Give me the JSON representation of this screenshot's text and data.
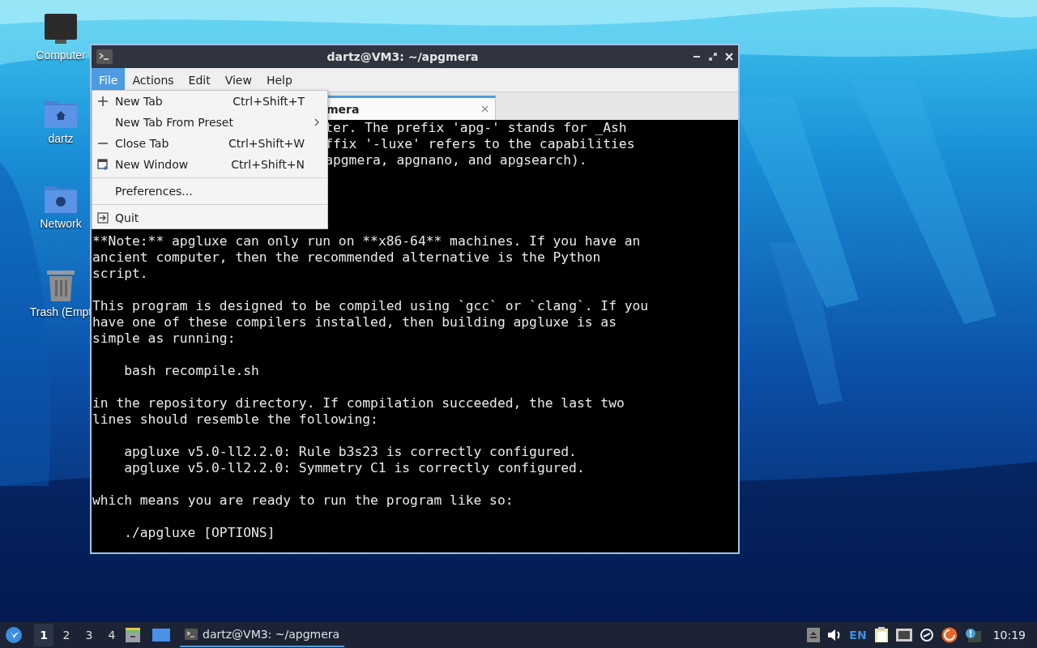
{
  "desktop_icons": [
    {
      "label": "Computer",
      "kind": "computer"
    },
    {
      "label": "dartz",
      "kind": "home"
    },
    {
      "label": "Network",
      "kind": "network"
    },
    {
      "label": "Trash (Empt",
      "kind": "trash"
    }
  ],
  "window": {
    "title": "dartz@VM3: ~/apgmera",
    "menu_bar": [
      {
        "label": "File",
        "selected": true
      },
      {
        "label": "Actions",
        "selected": false
      },
      {
        "label": "Edit",
        "selected": false
      },
      {
        "label": "View",
        "selected": false
      },
      {
        "label": "Help",
        "selected": false
      }
    ],
    "tab": {
      "label": "mera",
      "selected": true
    },
    "terminal": [
      {
        "kind": "clipped",
        "indented": false,
        "lines": [
          "ter. The prefix 'apg-' stands for _Ash",
          "ffix '-luxe' refers to the capabilities",
          "apgmera, apgnano, and apgsearch)."
        ]
      },
      {
        "kind": "text",
        "indented": false,
        "lines": [
          "**Note:** apgluxe can only run on **x86-64** machines. If you have an",
          "ancient computer, then the recommended alternative is the Python",
          "script."
        ]
      },
      {
        "kind": "text",
        "indented": false,
        "lines": [
          "This program is designed to be compiled using `gcc` or `clang`. If you",
          "have one of these compilers installed, then building apgluxe is as",
          "simple as running:"
        ]
      },
      {
        "kind": "text",
        "indented": true,
        "lines": [
          "bash recompile.sh"
        ]
      },
      {
        "kind": "text",
        "indented": false,
        "lines": [
          "in the repository directory. If compilation succeeded, the last two",
          "lines should resemble the following:"
        ]
      },
      {
        "kind": "text",
        "indented": true,
        "lines": [
          "apgluxe v5.0-ll2.2.0: Rule b3s23 is correctly configured.",
          "apgluxe v5.0-ll2.2.0: Symmetry C1 is correctly configured."
        ]
      },
      {
        "kind": "text",
        "indented": false,
        "lines": [
          "which means you are ready to run the program like so:"
        ]
      },
      {
        "kind": "text",
        "indented": true,
        "lines": [
          "./apgluxe [OPTIONS]"
        ]
      }
    ],
    "file_menu": [
      {
        "kind": "add",
        "label": "New Tab",
        "shortcut": "Ctrl+Shift+T",
        "submenu": false
      },
      {
        "kind": "plain",
        "label": "New Tab From Preset",
        "submenu": true
      },
      {
        "kind": "remove",
        "label": "Close Tab",
        "shortcut": "Ctrl+Shift+W",
        "submenu": false
      },
      {
        "kind": "window",
        "label": "New Window",
        "shortcut": "Ctrl+Shift+N",
        "submenu": false
      },
      {
        "kind": "separator"
      },
      {
        "kind": "plain",
        "label": "Preferences...",
        "submenu": false
      },
      {
        "kind": "separator"
      },
      {
        "kind": "exit",
        "label": "Quit",
        "submenu": false
      }
    ]
  },
  "taskbar": {
    "workspaces": [
      {
        "label": "1",
        "selected": true
      },
      {
        "label": "2",
        "selected": false
      },
      {
        "label": "3",
        "selected": false
      },
      {
        "label": "4",
        "selected": false
      }
    ],
    "task": {
      "label": "dartz@VM3: ~/apgmera",
      "selected": true
    },
    "keyboard_layout": "EN",
    "clock": "10:19"
  }
}
